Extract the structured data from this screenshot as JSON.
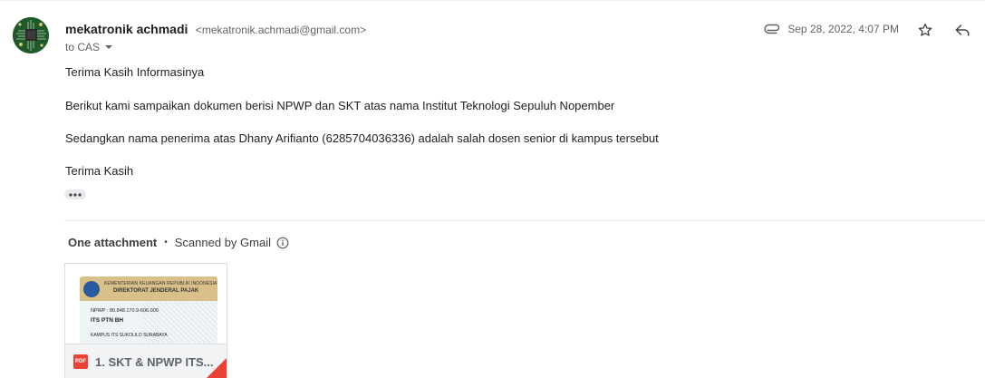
{
  "sender": {
    "name": "mekatronik achmadi",
    "email": "<mekatronik.achmadi@gmail.com>",
    "to_label": "to CAS",
    "avatar": "circuit-board-avatar"
  },
  "meta": {
    "date": "Sep 28, 2022, 4:07 PM",
    "icons": [
      "attachment-icon",
      "star-icon",
      "reply-icon"
    ]
  },
  "body": {
    "lines": [
      "Terima Kasih Informasinya",
      "Berikut kami sampaikan dokumen berisi NPWP dan SKT atas nama Institut Teknologi Sepuluh Nopember",
      "Sedangkan nama penerima atas Dhany Arifianto (6285704036336) adalah salah dosen senior di kampus tersebut",
      "Terima Kasih"
    ]
  },
  "attachments": {
    "count_label": "One attachment",
    "scan_label": "Scanned by Gmail",
    "file": {
      "name": "1. SKT & NPWP ITS...",
      "type_label": "PDF",
      "thumbnail": {
        "header_line1": "KEMENTERIAN KEUANGAN REPUBLIK INDONESIA",
        "header_line2": "DIREKTORAT JENDERAL PAJAK",
        "npwp": "NPWP : 80.848.170.9-606.000",
        "holder": "ITS PTN BH",
        "address": "KAMPUS ITS SUKOLILO SURABAYA"
      }
    }
  },
  "colors": {
    "accent_red": "#ea4335",
    "text_secondary": "#5f6368"
  }
}
